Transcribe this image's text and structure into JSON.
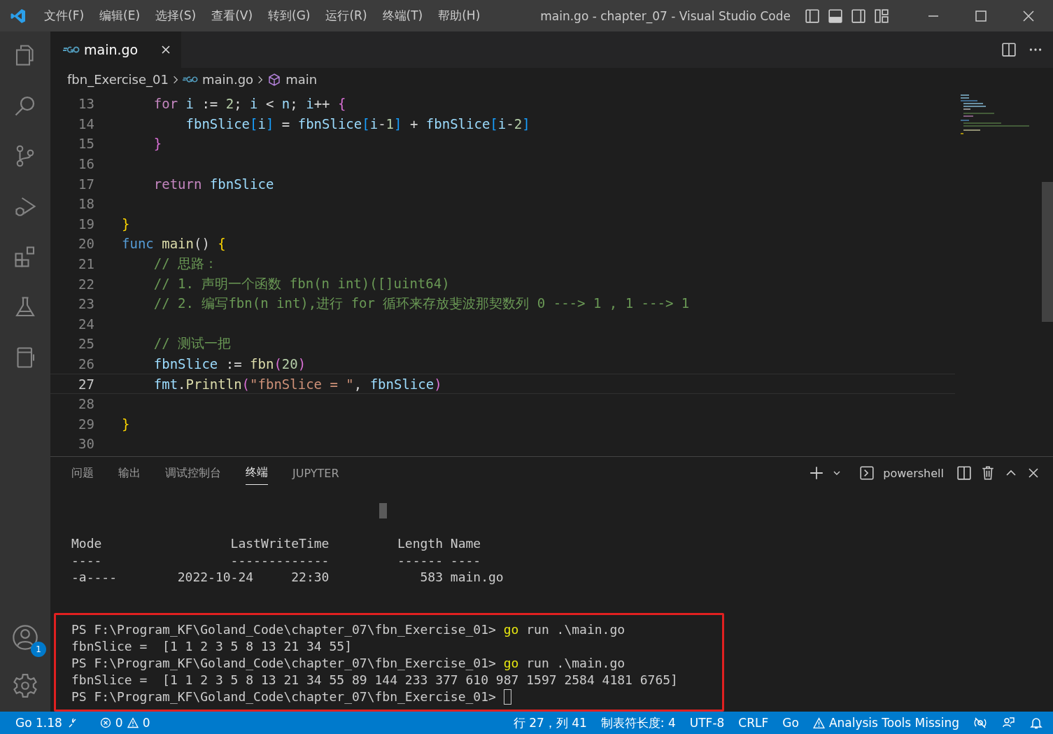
{
  "window": {
    "title": "main.go - chapter_07 - Visual Studio Code"
  },
  "menu": [
    "文件(F)",
    "编辑(E)",
    "选择(S)",
    "查看(V)",
    "转到(G)",
    "运行(R)",
    "终端(T)",
    "帮助(H)"
  ],
  "tabs": [
    {
      "label": "main.go",
      "selected": true
    }
  ],
  "breadcrumb": [
    "fbn_Exercise_01",
    "main.go",
    "main"
  ],
  "account_badge": "1",
  "editor": {
    "lines": [
      {
        "number": "13",
        "current": false,
        "tokens": [
          {
            "text": "    for",
            "kind": "ctl"
          },
          {
            "text": " i",
            "kind": "var"
          },
          {
            "text": " := ",
            "kind": "op"
          },
          {
            "text": "2",
            "kind": "num"
          },
          {
            "text": "; ",
            "kind": "op"
          },
          {
            "text": "i",
            "kind": "var"
          },
          {
            "text": " < ",
            "kind": "op"
          },
          {
            "text": "n",
            "kind": "var"
          },
          {
            "text": "; ",
            "kind": "op"
          },
          {
            "text": "i",
            "kind": "var"
          },
          {
            "text": "++ ",
            "kind": "op"
          },
          {
            "text": "{",
            "kind": "b2"
          }
        ]
      },
      {
        "number": "14",
        "current": false,
        "tokens": [
          {
            "text": "        fbnSlice",
            "kind": "var"
          },
          {
            "text": "[",
            "kind": "b3"
          },
          {
            "text": "i",
            "kind": "var"
          },
          {
            "text": "]",
            "kind": "b3"
          },
          {
            "text": " = ",
            "kind": "op"
          },
          {
            "text": "fbnSlice",
            "kind": "var"
          },
          {
            "text": "[",
            "kind": "b3"
          },
          {
            "text": "i",
            "kind": "var"
          },
          {
            "text": "-",
            "kind": "op"
          },
          {
            "text": "1",
            "kind": "num"
          },
          {
            "text": "]",
            "kind": "b3"
          },
          {
            "text": " + ",
            "kind": "op"
          },
          {
            "text": "fbnSlice",
            "kind": "var"
          },
          {
            "text": "[",
            "kind": "b3"
          },
          {
            "text": "i",
            "kind": "var"
          },
          {
            "text": "-",
            "kind": "op"
          },
          {
            "text": "2",
            "kind": "num"
          },
          {
            "text": "]",
            "kind": "b3"
          }
        ]
      },
      {
        "number": "15",
        "current": false,
        "tokens": [
          {
            "text": "    }",
            "kind": "b2"
          }
        ]
      },
      {
        "number": "16",
        "current": false
      },
      {
        "number": "17",
        "current": false,
        "tokens": [
          {
            "text": "    return",
            "kind": "ctl"
          },
          {
            "text": " fbnSlice",
            "kind": "var"
          }
        ]
      },
      {
        "number": "18",
        "current": false
      },
      {
        "number": "19",
        "current": false,
        "tokens": [
          {
            "text": "}",
            "kind": "b1"
          }
        ]
      },
      {
        "number": "20",
        "current": false,
        "tokens": [
          {
            "text": "func",
            "kind": "kw"
          },
          {
            "text": " main",
            "kind": "fn"
          },
          {
            "text": "() ",
            "kind": "op"
          },
          {
            "text": "{",
            "kind": "b1"
          }
        ]
      },
      {
        "number": "21",
        "current": false,
        "tokens": [
          {
            "text": "    // 思路：",
            "kind": "com"
          }
        ]
      },
      {
        "number": "22",
        "current": false,
        "tokens": [
          {
            "text": "    // 1. 声明一个函数 fbn(n int)([]uint64)",
            "kind": "com"
          }
        ]
      },
      {
        "number": "23",
        "current": false,
        "tokens": [
          {
            "text": "    // 2. 编写fbn(n int),进行 for 循环来存放斐波那契数列 0 ---> 1 , 1 ---> 1",
            "kind": "com"
          }
        ]
      },
      {
        "number": "24",
        "current": false
      },
      {
        "number": "25",
        "current": false,
        "tokens": [
          {
            "text": "    // 测试一把",
            "kind": "com"
          }
        ]
      },
      {
        "number": "26",
        "current": false,
        "tokens": [
          {
            "text": "    fbnSlice",
            "kind": "var"
          },
          {
            "text": " := ",
            "kind": "op"
          },
          {
            "text": "fbn",
            "kind": "fn"
          },
          {
            "text": "(",
            "kind": "b2"
          },
          {
            "text": "20",
            "kind": "num"
          },
          {
            "text": ")",
            "kind": "b2"
          }
        ]
      },
      {
        "number": "27",
        "current": true,
        "tokens": [
          {
            "text": "    fmt",
            "kind": "var"
          },
          {
            "text": ".",
            "kind": "op"
          },
          {
            "text": "Println",
            "kind": "fn"
          },
          {
            "text": "(",
            "kind": "b2"
          },
          {
            "text": "\"fbnSlice = \"",
            "kind": "str"
          },
          {
            "text": ", ",
            "kind": "op"
          },
          {
            "text": "fbnSlice",
            "kind": "var"
          },
          {
            "text": ")",
            "kind": "b2"
          }
        ]
      },
      {
        "number": "28",
        "current": false
      },
      {
        "number": "29",
        "current": false,
        "tokens": [
          {
            "text": "}",
            "kind": "b1"
          }
        ]
      },
      {
        "number": "30",
        "current": false
      }
    ]
  },
  "panel": {
    "tabs": [
      {
        "label": "问题",
        "selected": false
      },
      {
        "label": "输出",
        "selected": false
      },
      {
        "label": "调试控制台",
        "selected": false
      },
      {
        "label": "终端",
        "selected": true
      },
      {
        "label": "JUPYTER",
        "selected": false
      }
    ],
    "shell": "powershell",
    "listing": [
      "Mode                 LastWriteTime         Length Name",
      "----                 -------------         ------ ----",
      "-a----        2022-10-24     22:30            583 main.go"
    ],
    "output": [
      [
        {
          "text": "PS F:\\Program_KF\\Goland_Code\\chapter_07\\fbn_Exercise_01> ",
          "kind": "plain"
        },
        {
          "text": "go",
          "kind": "cmd"
        },
        {
          "text": " run .\\main.go",
          "kind": "plain"
        }
      ],
      [
        {
          "text": "fbnSlice =  [1 1 2 3 5 8 13 21 34 55]",
          "kind": "plain"
        }
      ],
      [
        {
          "text": "PS F:\\Program_KF\\Goland_Code\\chapter_07\\fbn_Exercise_01> ",
          "kind": "plain"
        },
        {
          "text": "go",
          "kind": "cmd"
        },
        {
          "text": " run .\\main.go",
          "kind": "plain"
        }
      ],
      [
        {
          "text": "fbnSlice =  [1 1 2 3 5 8 13 21 34 55 89 144 233 377 610 987 1597 2584 4181 6765]",
          "kind": "plain"
        }
      ],
      [
        {
          "text": "PS F:\\Program_KF\\Goland_Code\\chapter_07\\fbn_Exercise_01> ",
          "kind": "plain"
        }
      ]
    ]
  },
  "status_bar": {
    "go_version": "Go 1.18",
    "errors": "0",
    "warnings": "0",
    "right": [
      "行 27，列 41",
      "制表符长度: 4",
      "UTF-8",
      "CRLF",
      "Go"
    ],
    "analysis": "Analysis Tools Missing"
  }
}
